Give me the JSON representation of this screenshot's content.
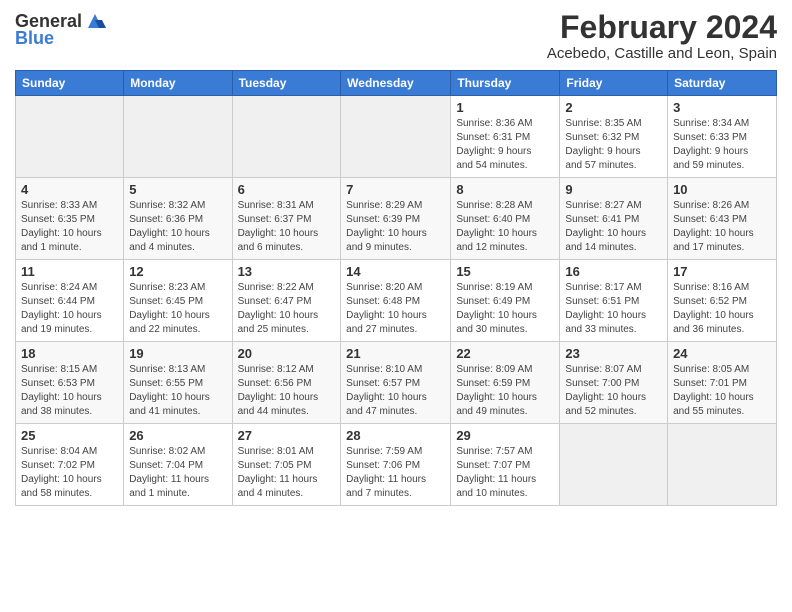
{
  "logo": {
    "general": "General",
    "blue": "Blue"
  },
  "header": {
    "month_year": "February 2024",
    "location": "Acebedo, Castille and Leon, Spain"
  },
  "weekdays": [
    "Sunday",
    "Monday",
    "Tuesday",
    "Wednesday",
    "Thursday",
    "Friday",
    "Saturday"
  ],
  "weeks": [
    [
      {
        "day": "",
        "info": ""
      },
      {
        "day": "",
        "info": ""
      },
      {
        "day": "",
        "info": ""
      },
      {
        "day": "",
        "info": ""
      },
      {
        "day": "1",
        "info": "Sunrise: 8:36 AM\nSunset: 6:31 PM\nDaylight: 9 hours\nand 54 minutes."
      },
      {
        "day": "2",
        "info": "Sunrise: 8:35 AM\nSunset: 6:32 PM\nDaylight: 9 hours\nand 57 minutes."
      },
      {
        "day": "3",
        "info": "Sunrise: 8:34 AM\nSunset: 6:33 PM\nDaylight: 9 hours\nand 59 minutes."
      }
    ],
    [
      {
        "day": "4",
        "info": "Sunrise: 8:33 AM\nSunset: 6:35 PM\nDaylight: 10 hours\nand 1 minute."
      },
      {
        "day": "5",
        "info": "Sunrise: 8:32 AM\nSunset: 6:36 PM\nDaylight: 10 hours\nand 4 minutes."
      },
      {
        "day": "6",
        "info": "Sunrise: 8:31 AM\nSunset: 6:37 PM\nDaylight: 10 hours\nand 6 minutes."
      },
      {
        "day": "7",
        "info": "Sunrise: 8:29 AM\nSunset: 6:39 PM\nDaylight: 10 hours\nand 9 minutes."
      },
      {
        "day": "8",
        "info": "Sunrise: 8:28 AM\nSunset: 6:40 PM\nDaylight: 10 hours\nand 12 minutes."
      },
      {
        "day": "9",
        "info": "Sunrise: 8:27 AM\nSunset: 6:41 PM\nDaylight: 10 hours\nand 14 minutes."
      },
      {
        "day": "10",
        "info": "Sunrise: 8:26 AM\nSunset: 6:43 PM\nDaylight: 10 hours\nand 17 minutes."
      }
    ],
    [
      {
        "day": "11",
        "info": "Sunrise: 8:24 AM\nSunset: 6:44 PM\nDaylight: 10 hours\nand 19 minutes."
      },
      {
        "day": "12",
        "info": "Sunrise: 8:23 AM\nSunset: 6:45 PM\nDaylight: 10 hours\nand 22 minutes."
      },
      {
        "day": "13",
        "info": "Sunrise: 8:22 AM\nSunset: 6:47 PM\nDaylight: 10 hours\nand 25 minutes."
      },
      {
        "day": "14",
        "info": "Sunrise: 8:20 AM\nSunset: 6:48 PM\nDaylight: 10 hours\nand 27 minutes."
      },
      {
        "day": "15",
        "info": "Sunrise: 8:19 AM\nSunset: 6:49 PM\nDaylight: 10 hours\nand 30 minutes."
      },
      {
        "day": "16",
        "info": "Sunrise: 8:17 AM\nSunset: 6:51 PM\nDaylight: 10 hours\nand 33 minutes."
      },
      {
        "day": "17",
        "info": "Sunrise: 8:16 AM\nSunset: 6:52 PM\nDaylight: 10 hours\nand 36 minutes."
      }
    ],
    [
      {
        "day": "18",
        "info": "Sunrise: 8:15 AM\nSunset: 6:53 PM\nDaylight: 10 hours\nand 38 minutes."
      },
      {
        "day": "19",
        "info": "Sunrise: 8:13 AM\nSunset: 6:55 PM\nDaylight: 10 hours\nand 41 minutes."
      },
      {
        "day": "20",
        "info": "Sunrise: 8:12 AM\nSunset: 6:56 PM\nDaylight: 10 hours\nand 44 minutes."
      },
      {
        "day": "21",
        "info": "Sunrise: 8:10 AM\nSunset: 6:57 PM\nDaylight: 10 hours\nand 47 minutes."
      },
      {
        "day": "22",
        "info": "Sunrise: 8:09 AM\nSunset: 6:59 PM\nDaylight: 10 hours\nand 49 minutes."
      },
      {
        "day": "23",
        "info": "Sunrise: 8:07 AM\nSunset: 7:00 PM\nDaylight: 10 hours\nand 52 minutes."
      },
      {
        "day": "24",
        "info": "Sunrise: 8:05 AM\nSunset: 7:01 PM\nDaylight: 10 hours\nand 55 minutes."
      }
    ],
    [
      {
        "day": "25",
        "info": "Sunrise: 8:04 AM\nSunset: 7:02 PM\nDaylight: 10 hours\nand 58 minutes."
      },
      {
        "day": "26",
        "info": "Sunrise: 8:02 AM\nSunset: 7:04 PM\nDaylight: 11 hours\nand 1 minute."
      },
      {
        "day": "27",
        "info": "Sunrise: 8:01 AM\nSunset: 7:05 PM\nDaylight: 11 hours\nand 4 minutes."
      },
      {
        "day": "28",
        "info": "Sunrise: 7:59 AM\nSunset: 7:06 PM\nDaylight: 11 hours\nand 7 minutes."
      },
      {
        "day": "29",
        "info": "Sunrise: 7:57 AM\nSunset: 7:07 PM\nDaylight: 11 hours\nand 10 minutes."
      },
      {
        "day": "",
        "info": ""
      },
      {
        "day": "",
        "info": ""
      }
    ]
  ]
}
